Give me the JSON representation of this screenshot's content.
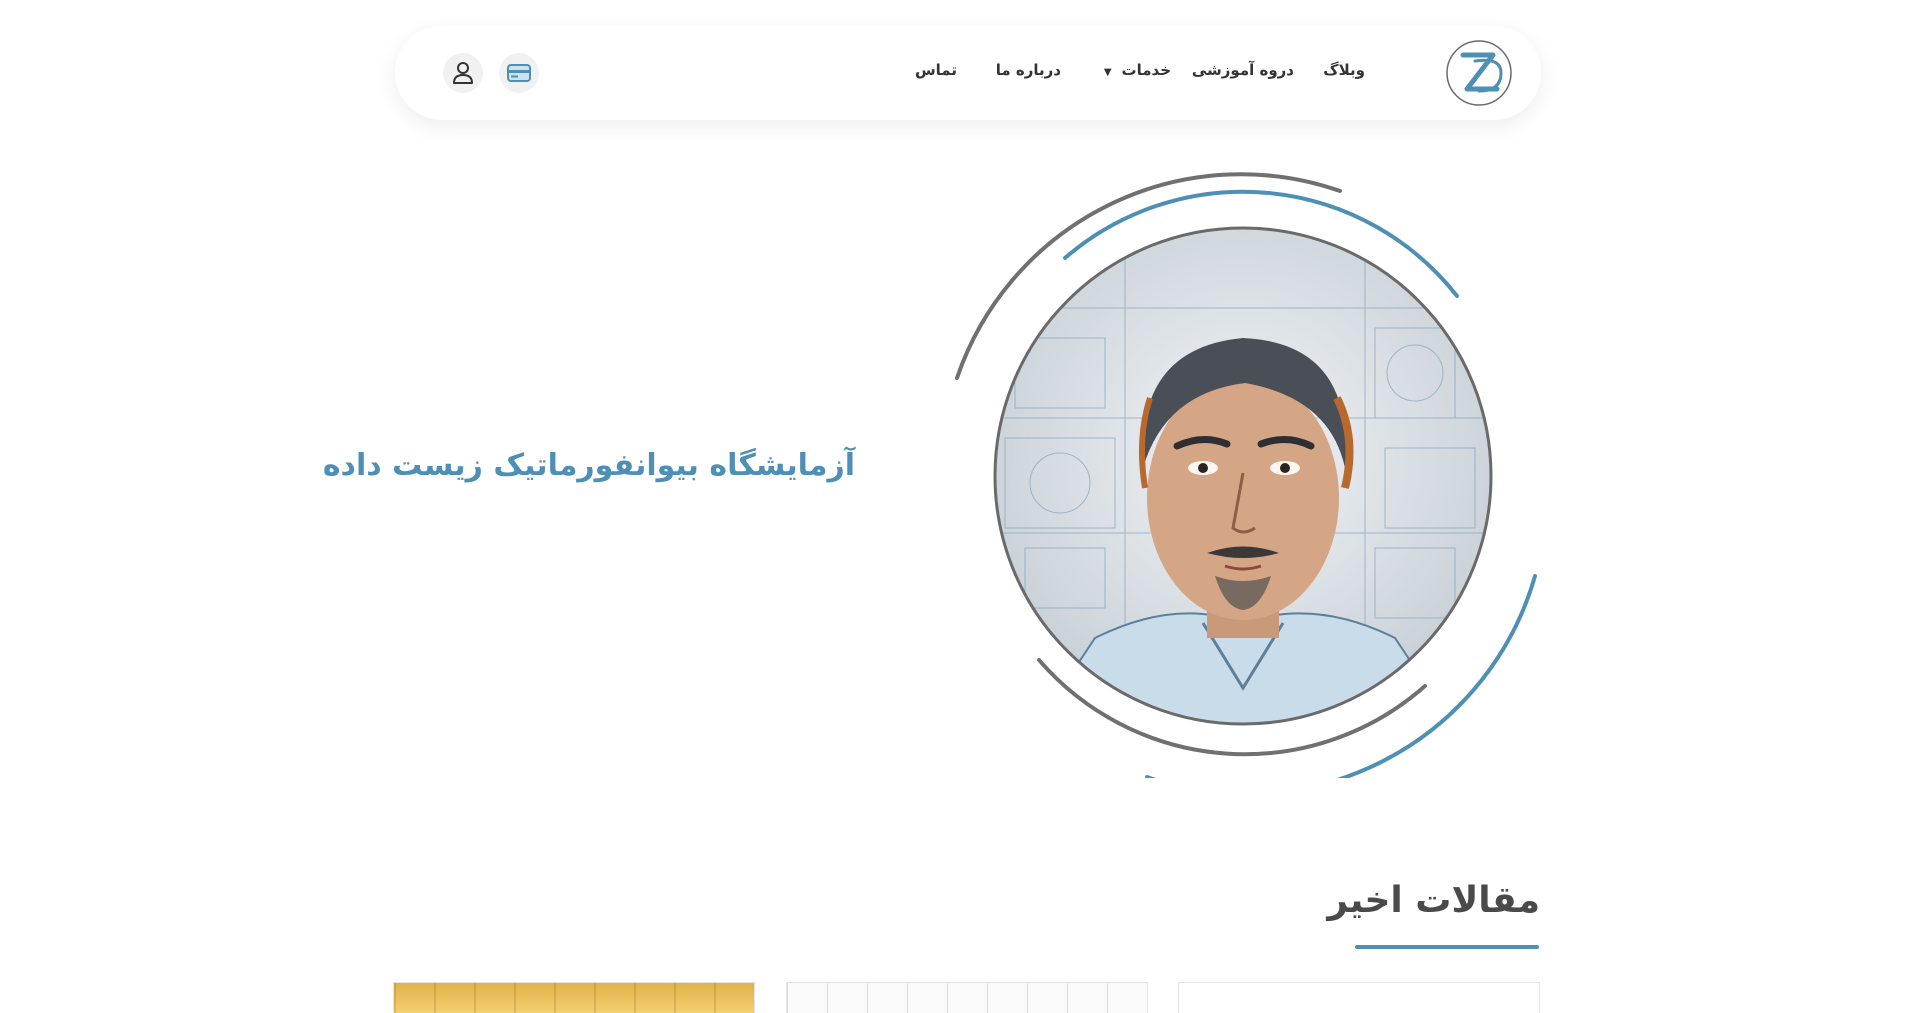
{
  "header": {
    "nav": {
      "blog": "وبلاگ",
      "course": "دروه آموزشی",
      "services": "خدمات",
      "about": "درباره ما",
      "contact": "تماس"
    },
    "icons": {
      "logo": "zistdade-logo",
      "card": "card-icon",
      "user": "user-icon",
      "chevron": "chevron-down-icon"
    }
  },
  "hero": {
    "title": "آزمایشگاه بیوانفورماتیک زیست داده"
  },
  "recent_articles": {
    "title": "مقالات اخیر"
  },
  "colors": {
    "accent": "#4e8fb6",
    "dark_ring": "#6b6b6b",
    "header_bg": "#ffffff",
    "icon_bg": "#f1f1f1"
  }
}
